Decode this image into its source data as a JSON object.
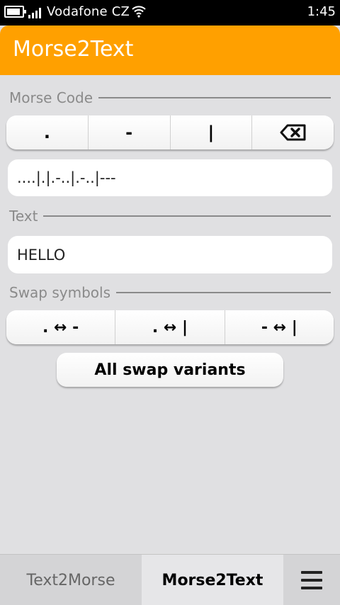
{
  "status_bar": {
    "carrier": "Vodafone CZ",
    "time": "1:45",
    "icons": [
      "battery-icon",
      "signal-icon",
      "wifi-icon"
    ]
  },
  "header": {
    "title": "Morse2Text"
  },
  "morse_section": {
    "label": "Morse Code",
    "keys": [
      ".",
      "-",
      "|"
    ],
    "backspace_icon": "backspace-icon",
    "value": "....|.|.-..|.-..|---"
  },
  "text_section": {
    "label": "Text",
    "value": "HELLO"
  },
  "swap_section": {
    "label": "Swap symbols",
    "buttons": [
      ". ↔ -",
      ". ↔ |",
      "- ↔ |"
    ],
    "all_variants_label": "All swap variants"
  },
  "tabs": {
    "items": [
      "Text2Morse",
      "Morse2Text"
    ],
    "active": "Morse2Text",
    "menu_icon": "menu-icon"
  },
  "colors": {
    "accent": "#ffa000",
    "background": "#e0e0e2"
  }
}
